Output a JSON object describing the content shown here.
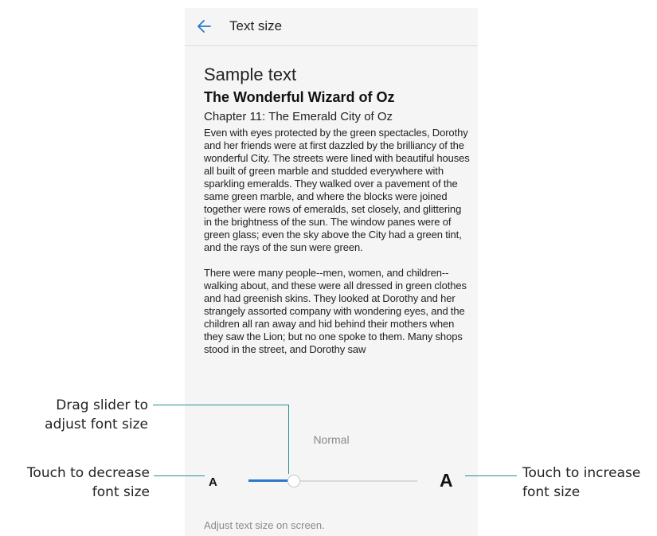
{
  "header": {
    "title": "Text size"
  },
  "sample": {
    "label": "Sample text",
    "book_title": "The Wonderful Wizard of Oz",
    "chapter": "Chapter 11: The Emerald City of Oz",
    "paragraph_1": "Even with eyes protected by the green spectacles, Dorothy and her friends were at first dazzled by the brilliancy of the wonderful City. The streets were lined with beautiful houses all built of green marble and studded everywhere with sparkling emeralds. They walked over a pavement of the same green marble, and where the blocks were joined together were rows of emeralds, set closely, and glittering in the brightness of the sun. The window panes were of green glass; even the sky above the City had a green tint, and the rays of the sun were green.",
    "paragraph_2": "There were many people--men, women, and children--walking about, and these were all dressed in green clothes and had greenish skins. They looked at Dorothy and her strangely assorted company with wondering eyes, and the children all ran away and hid behind their mothers when they saw the Lion; but no one spoke to them. Many shops stood in the street, and Dorothy saw"
  },
  "size_control": {
    "current_label": "Normal",
    "small_label": "A",
    "large_label": "A",
    "level_fraction": 0.27
  },
  "hint": "Adjust text size on screen.",
  "callouts": {
    "slider_line1": "Drag slider to",
    "slider_line2": "adjust font size",
    "decrease_line1": "Touch to decrease",
    "decrease_line2": "font size",
    "increase_line1": "Touch to increase",
    "increase_line2": "font size"
  },
  "colors": {
    "accent": "#2d78c8",
    "callout_line": "#2a8f8f",
    "background": "#f5f5f5"
  },
  "icons": {
    "back": "back-arrow-icon"
  }
}
